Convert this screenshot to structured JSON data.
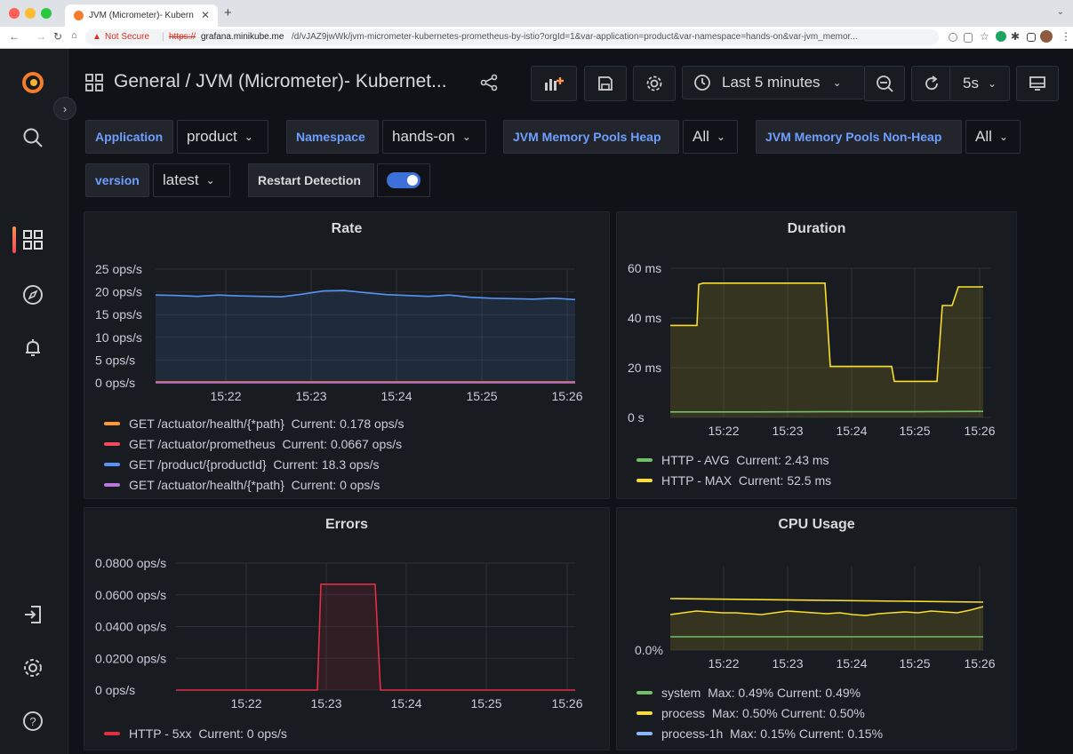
{
  "browser": {
    "tab_title": "JVM (Micrometer)- Kubernetes",
    "not_secure": "Not Secure",
    "url_scheme": "https://",
    "url_host": "grafana.minikube.me",
    "url_path": "/d/vJAZ9jwWk/jvm-micrometer-kubernetes-prometheus-by-istio?orgId=1&var-application=product&var-namespace=hands-on&var-jvm_memor..."
  },
  "header": {
    "breadcrumb": "General  /  JVM (Micrometer)- Kubernet...",
    "time_range": "Last 5 minutes",
    "refresh_interval": "5s"
  },
  "variables": {
    "application": {
      "label": "Application",
      "value": "product"
    },
    "namespace": {
      "label": "Namespace",
      "value": "hands-on"
    },
    "heap": {
      "label": "JVM Memory Pools Heap",
      "value": "All"
    },
    "nonheap": {
      "label": "JVM Memory Pools Non-Heap",
      "value": "All"
    },
    "version": {
      "label": "version",
      "value": "latest"
    },
    "restart": {
      "label": "Restart Detection",
      "enabled": true
    }
  },
  "colors": {
    "accent": "#6e9fff",
    "orange": "#ff9830",
    "red": "#f2495c",
    "blue": "#5794f2",
    "purple": "#b877d9",
    "green": "#73bf69",
    "yellow": "#fade2a",
    "cyan": "#8ab8ff"
  },
  "chart_data": [
    {
      "id": "rate",
      "type": "line",
      "title": "Rate",
      "x_ticks": [
        "15:22",
        "15:23",
        "15:24",
        "15:25",
        "15:26"
      ],
      "y_ticks": [
        "25 ops/s",
        "20 ops/s",
        "15 ops/s",
        "10 ops/s",
        "5 ops/s",
        "0 ops/s"
      ],
      "ylim": [
        0,
        25
      ],
      "x": [
        15.35,
        15.367,
        15.383,
        15.4,
        15.417,
        15.433
      ],
      "series": [
        {
          "name": "GET /actuator/health/{*path}",
          "current": "Current: 0.178 ops/s",
          "color": "#ff9830",
          "values": [
            0.18,
            0.18,
            0.18,
            0.18,
            0.18,
            0.18
          ]
        },
        {
          "name": "GET /actuator/prometheus",
          "current": "Current: 0.0667 ops/s",
          "color": "#f2495c",
          "values": [
            0.07,
            0.07,
            0.07,
            0.07,
            0.07,
            0.07
          ]
        },
        {
          "name": "GET /product/{productId}",
          "current": "Current: 18.3 ops/s",
          "color": "#5794f2",
          "values": [
            19.2,
            19,
            20.2,
            19.2,
            18.5,
            18.3
          ]
        },
        {
          "name": "GET /actuator/health/{*path}",
          "current": "Current: 0 ops/s",
          "color": "#b877d9",
          "values": [
            0,
            0,
            0,
            0,
            0,
            0
          ]
        }
      ]
    },
    {
      "id": "duration",
      "type": "line",
      "title": "Duration",
      "x_ticks": [
        "15:22",
        "15:23",
        "15:24",
        "15:25",
        "15:26"
      ],
      "y_ticks": [
        "60 ms",
        "40 ms",
        "20 ms",
        "0 s"
      ],
      "ylim": [
        0,
        60
      ],
      "series": [
        {
          "name": "HTTP - AVG",
          "current": "Current: 2.43 ms",
          "color": "#73bf69",
          "values": [
            2.2,
            2.2,
            2.3,
            2.3,
            2.4,
            2.43
          ]
        },
        {
          "name": "HTTP - MAX",
          "current": "Current: 52.5 ms",
          "color": "#fade2a",
          "values": [
            37,
            54,
            54,
            20.5,
            14.5,
            52.5
          ]
        }
      ]
    },
    {
      "id": "errors",
      "type": "line",
      "title": "Errors",
      "x_ticks": [
        "15:22",
        "15:23",
        "15:24",
        "15:25",
        "15:26"
      ],
      "y_ticks": [
        "0.0800 ops/s",
        "0.0600 ops/s",
        "0.0400 ops/s",
        "0.0200 ops/s",
        "0 ops/s"
      ],
      "ylim": [
        0,
        0.08
      ],
      "series": [
        {
          "name": "HTTP - 5xx",
          "current": "Current: 0 ops/s",
          "color": "#e02f44",
          "values": [
            0,
            0,
            0.0667,
            0,
            0,
            0
          ]
        }
      ]
    },
    {
      "id": "cpu",
      "type": "line",
      "title": "CPU Usage",
      "x_ticks": [
        "15:22",
        "15:23",
        "15:24",
        "15:25",
        "15:26"
      ],
      "y_ticks": [
        "0.0%"
      ],
      "series": [
        {
          "name": "system",
          "current": "Max: 0.49%  Current: 0.49%",
          "color": "#73bf69"
        },
        {
          "name": "process",
          "current": "Max: 0.50%  Current: 0.50%",
          "color": "#fade2a"
        },
        {
          "name": "process-1h",
          "current": "Max: 0.15%  Current: 0.15%",
          "color": "#8ab8ff"
        }
      ]
    }
  ]
}
